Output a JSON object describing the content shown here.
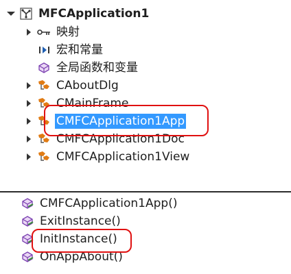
{
  "tree": {
    "root_label": "MFCApplication1",
    "items": [
      {
        "label": "映射",
        "icon": "map-icon"
      },
      {
        "label": "宏和常量",
        "icon": "macro-icon"
      },
      {
        "label": "全局函数和变量",
        "icon": "global-functions-icon"
      },
      {
        "label": "CAboutDlg",
        "icon": "class-icon"
      },
      {
        "label": "CMainFrame",
        "icon": "class-icon"
      },
      {
        "label": "CMFCApplication1App",
        "icon": "class-icon",
        "selected": true
      },
      {
        "label": "CMFCApplication1Doc",
        "icon": "class-icon"
      },
      {
        "label": "CMFCApplication1View",
        "icon": "class-icon"
      }
    ]
  },
  "members": {
    "items": [
      {
        "label": "CMFCApplication1App()",
        "icon": "method-icon"
      },
      {
        "label": "ExitInstance()",
        "icon": "method-icon"
      },
      {
        "label": "InitInstance()",
        "icon": "method-icon"
      },
      {
        "label": "OnAppAbout()",
        "icon": "method-icon"
      }
    ]
  },
  "colors": {
    "selection": "#3399ff",
    "annotation": "#e01010",
    "class_icon": "#e07b14",
    "method_icon": "#7a3fb0"
  }
}
